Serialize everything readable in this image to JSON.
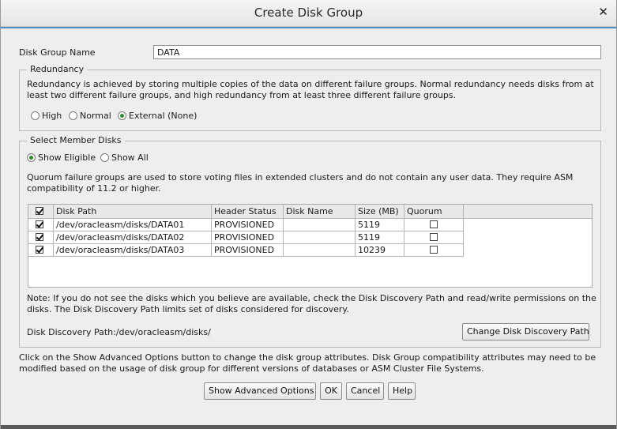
{
  "window": {
    "title": "Create Disk Group",
    "close_glyph": "✕"
  },
  "disk_group_name": {
    "label": "Disk Group Name",
    "value": "DATA"
  },
  "redundancy": {
    "legend": "Redundancy",
    "description_line1": "Redundancy is achieved by storing multiple copies of the data on different failure groups. Normal redundancy needs disks from at",
    "description_line2": "least two different failure groups, and high redundancy from at least three different failure groups.",
    "options": [
      {
        "label": "High",
        "selected": false
      },
      {
        "label": "Normal",
        "selected": false
      },
      {
        "label": "External (None)",
        "selected": true
      }
    ]
  },
  "member_disks": {
    "legend": "Select Member Disks",
    "filters": [
      {
        "label": "Show Eligible",
        "selected": true
      },
      {
        "label": "Show All",
        "selected": false
      }
    ],
    "quorum_note_line1": "Quorum failure groups are used to store voting files in extended clusters and do not contain any user data. They require ASM",
    "quorum_note_line2": "compatibility of 11.2 or higher.",
    "table": {
      "columns": [
        "Disk Path",
        "Header Status",
        "Disk Name",
        "Size (MB)",
        "Quorum"
      ],
      "select_all_checked": true,
      "rows": [
        {
          "selected": true,
          "disk_path": "/dev/oracleasm/disks/DATA01",
          "header_status": "PROVISIONED",
          "disk_name": "",
          "size_mb": "5119",
          "quorum": false
        },
        {
          "selected": true,
          "disk_path": "/dev/oracleasm/disks/DATA02",
          "header_status": "PROVISIONED",
          "disk_name": "",
          "size_mb": "5119",
          "quorum": false
        },
        {
          "selected": true,
          "disk_path": "/dev/oracleasm/disks/DATA03",
          "header_status": "PROVISIONED",
          "disk_name": "",
          "size_mb": "10239",
          "quorum": false
        }
      ]
    },
    "note_line1": "Note: If you do not see the disks which you believe are available, check the Disk Discovery Path and read/write permissions on the",
    "note_line2": "disks. The Disk Discovery Path limits set of disks considered for discovery.",
    "discovery_path": "Disk Discovery Path:/dev/oracleasm/disks/",
    "change_path_button": "Change Disk Discovery Path"
  },
  "advanced": {
    "info_line1": "Click on the Show Advanced Options button to change the disk group attributes. Disk Group compatibility attributes may need to be",
    "info_line2": "modified based on the usage of disk group for different versions of databases or ASM Cluster File Systems."
  },
  "buttons": {
    "show_advanced": "Show Advanced Options",
    "ok": "OK",
    "cancel": "Cancel",
    "help": "Help"
  },
  "colors": {
    "accent": "#4a90c8",
    "radio_selected": "#2e8b2e"
  }
}
